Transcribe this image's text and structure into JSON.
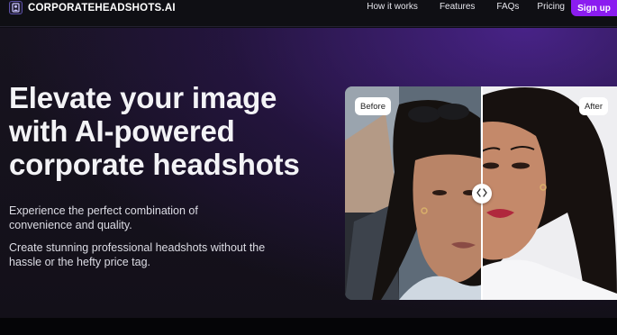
{
  "brand": {
    "name": "CORPORATEHEADSHOTS.AI",
    "logo_icon": "logo-mark-icon"
  },
  "nav": {
    "links": [
      "How it works",
      "Features",
      "FAQs",
      "Pricing"
    ],
    "signup_label": "Sign up"
  },
  "hero": {
    "headline_line1": "Elevate your image",
    "headline_line2": "with AI-powered",
    "headline_line3": "corporate headshots",
    "paragraph1": "Experience the perfect combination of convenience and quality.",
    "paragraph2": "Create stunning professional headshots without the hassle or the hefty price tag."
  },
  "compare": {
    "before_label": "Before",
    "after_label": "After",
    "handle_icon": "chevron-left-right-icon",
    "slider_position": 0.5
  },
  "colors": {
    "accent": "#8b1cf0",
    "background": "#141019",
    "nav_background": "#0f0f14"
  }
}
